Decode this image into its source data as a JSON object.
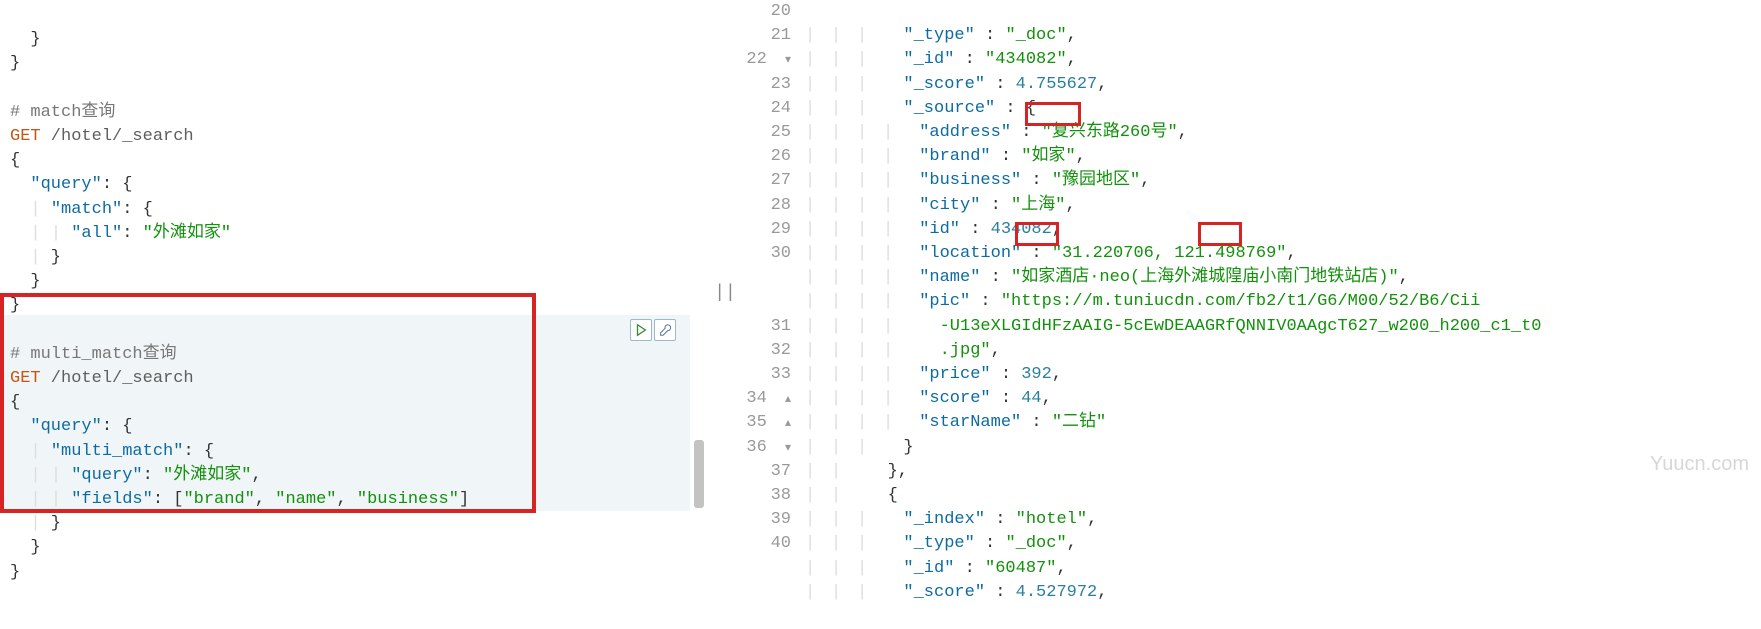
{
  "left": {
    "close1": "  }",
    "close2": "}",
    "comment1": "# match查询",
    "method": "GET",
    "endpoint": " /hotel/_search",
    "open1": "{",
    "q_key": "\"query\"",
    "q_open": ": {",
    "match_key": "\"match\"",
    "match_open": ": {",
    "all_key": "\"all\"",
    "all_val": "\"外滩如家\"",
    "close3": "    }",
    "close4": "  }",
    "close5": "}",
    "comment2": "# multi_match查询",
    "method2": "GET",
    "endpoint2": " /hotel/_search",
    "open2": "{",
    "mm_qkey": "\"query\"",
    "mm_key": "\"multi_match\"",
    "mm_query_key": "\"query\"",
    "mm_query_val": "\"外滩如家\"",
    "mm_fields_key": "\"fields\"",
    "mm_f1": "\"brand\"",
    "mm_f2": "\"name\"",
    "mm_f3": "\"business\"",
    "close6": "    }",
    "close7": "  }",
    "close8": "}"
  },
  "right": {
    "lines": {
      "20": {
        "key": "\"_id\"",
        "val": "\"434082\""
      },
      "21": {
        "key": "\"_score\"",
        "val": "4.755627"
      },
      "22": {
        "key": "\"_source\""
      },
      "23": {
        "key": "\"address\"",
        "val": "\"复兴东路260号\""
      },
      "24": {
        "key": "\"brand\"",
        "pre": "\"",
        "hl": "如家",
        "post": "\""
      },
      "25": {
        "key": "\"business\"",
        "val": "\"豫园地区\""
      },
      "26": {
        "key": "\"city\"",
        "val": "\"上海\""
      },
      "27": {
        "key": "\"id\"",
        "val": "434082"
      },
      "28": {
        "key": "\"location\"",
        "val": "\"31.220706, 121.498769\""
      },
      "29": {
        "key": "\"name\"",
        "pre": "\"",
        "hl1": "如家",
        "mid1": "酒店·neo(上海",
        "hl2": "外滩",
        "mid2": "城隍庙小南门地铁站店)\""
      },
      "30a": {
        "key": "\"pic\"",
        "val": "\"https://m.tuniucdn.com/fb2/t1/G6/M00/52/B6/Cii"
      },
      "30b": "-U13eXLGIdHFzAAIG-5cEwDEAAGRfQNNIV0AAgcT627_w200_h200_c1_t0",
      "30c": ".jpg\"",
      "31": {
        "key": "\"price\"",
        "val": "392"
      },
      "32": {
        "key": "\"score\"",
        "val": "44"
      },
      "33": {
        "key": "\"starName\"",
        "val": "\"二钻\""
      },
      "37": {
        "key": "\"_index\"",
        "val": "\"hotel\""
      },
      "38": {
        "key": "\"_type\"",
        "val": "\"_doc\""
      },
      "39": {
        "key": "\"_id\"",
        "val": "\"60487\""
      },
      "40": {
        "key": "\"_score\"",
        "val": "4.527972"
      }
    },
    "type_key": "\"_type\"",
    "type_val": "\"_doc\""
  },
  "watermark": "Yuucn.com"
}
